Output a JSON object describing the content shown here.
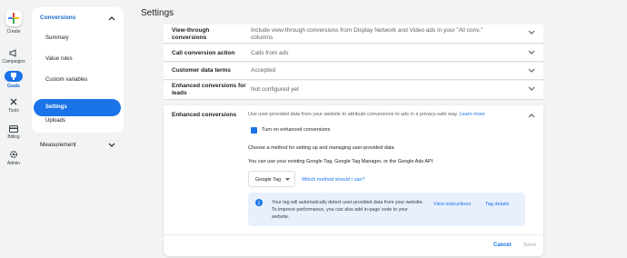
{
  "page_title": "Settings",
  "rail": {
    "create": "Create",
    "campaigns": "Campaigns",
    "goals": "Goals",
    "tools": "Tools",
    "billing": "Billing",
    "admin": "Admin"
  },
  "sidebar": {
    "section": "Conversions",
    "items": [
      "Summary",
      "Value rules",
      "Custom variables",
      "Settings",
      "Uploads"
    ],
    "measurement": "Measurement"
  },
  "rows": [
    {
      "label_lines": [
        "View-through",
        "conversions"
      ],
      "value_lines": [
        "Include view-through conversions from Display Network and Video ads in your \"All conv.\"",
        "columns"
      ]
    },
    {
      "label_lines": [
        "Call conversion action"
      ],
      "value_lines": [
        "Calls from ads"
      ]
    },
    {
      "label_lines": [
        "Customer data terms"
      ],
      "value_lines": [
        "Accepted"
      ]
    },
    {
      "label_lines": [
        "Enhanced conversions for",
        "leads"
      ],
      "value_lines": [
        "Not configured yet"
      ]
    }
  ],
  "enhanced": {
    "label": "Enhanced conversions",
    "description": "Use user-provided data from your website to attribute conversions to ads in a privacy-safe way.",
    "learn_more": "Learn more",
    "checkbox_label": "Turn on enhanced conversions",
    "method_text": "Choose a method for setting up and managing user-provided data",
    "api_text": "You can use your existing Google Tag, Google Tag Manager, or the Google Ads API",
    "dropdown_value": "Google Tag",
    "which_method": "Which method should I use?",
    "info_text": "Your tag will automatically detect user-provided data from your website. To improve performance, you can also add in-page code to your website.",
    "view_instructions": "View instructions",
    "tag_details": "Tag details",
    "cancel": "Cancel",
    "save": "Save"
  },
  "colors": {
    "accent": "#1a73e8",
    "background": "#f1f3f4",
    "info_bg": "#e8f0fe"
  }
}
